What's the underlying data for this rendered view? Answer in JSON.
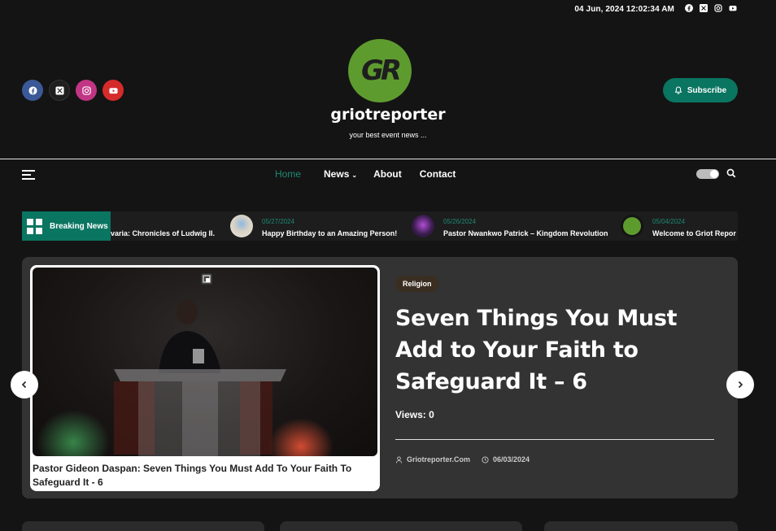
{
  "topbar": {
    "datetime": "04 Jun, 2024 12:02:34 AM",
    "social_icons": [
      "facebook-icon",
      "x-twitter-icon",
      "instagram-icon",
      "youtube-icon"
    ]
  },
  "header": {
    "logo_text": "GR",
    "site_title": "griotreporter",
    "tagline": "your best event news ...",
    "subscribe_label": "Subscribe",
    "colors": {
      "logo": "#5e9b2f",
      "accent": "#0a7561"
    }
  },
  "nav": {
    "items": [
      {
        "label": "Home"
      },
      {
        "label": "News"
      },
      {
        "label": "About"
      },
      {
        "label": "Contact"
      }
    ]
  },
  "ticker": {
    "label": "Breaking News",
    "items": [
      {
        "date": "",
        "title": "varia: Chronicles of Ludwig II."
      },
      {
        "date": "05/27/2024",
        "title": "Happy Birthday to an Amazing Person!"
      },
      {
        "date": "05/26/2024",
        "title": "Pastor Nwankwo Patrick – Kingdom Revolution"
      },
      {
        "date": "05/04/2024",
        "title": "Welcome to Griot Repor"
      }
    ]
  },
  "hero": {
    "caption": "Pastor Gideon Daspan: Seven Things You Must Add To Your Faith To Safeguard It - 6",
    "category": "Religion",
    "headline": "Seven Things You Must Add to Your Faith to Safeguard It – 6",
    "views": "Views: 0",
    "author": "Griotreporter.Com",
    "date": "06/03/2024"
  }
}
